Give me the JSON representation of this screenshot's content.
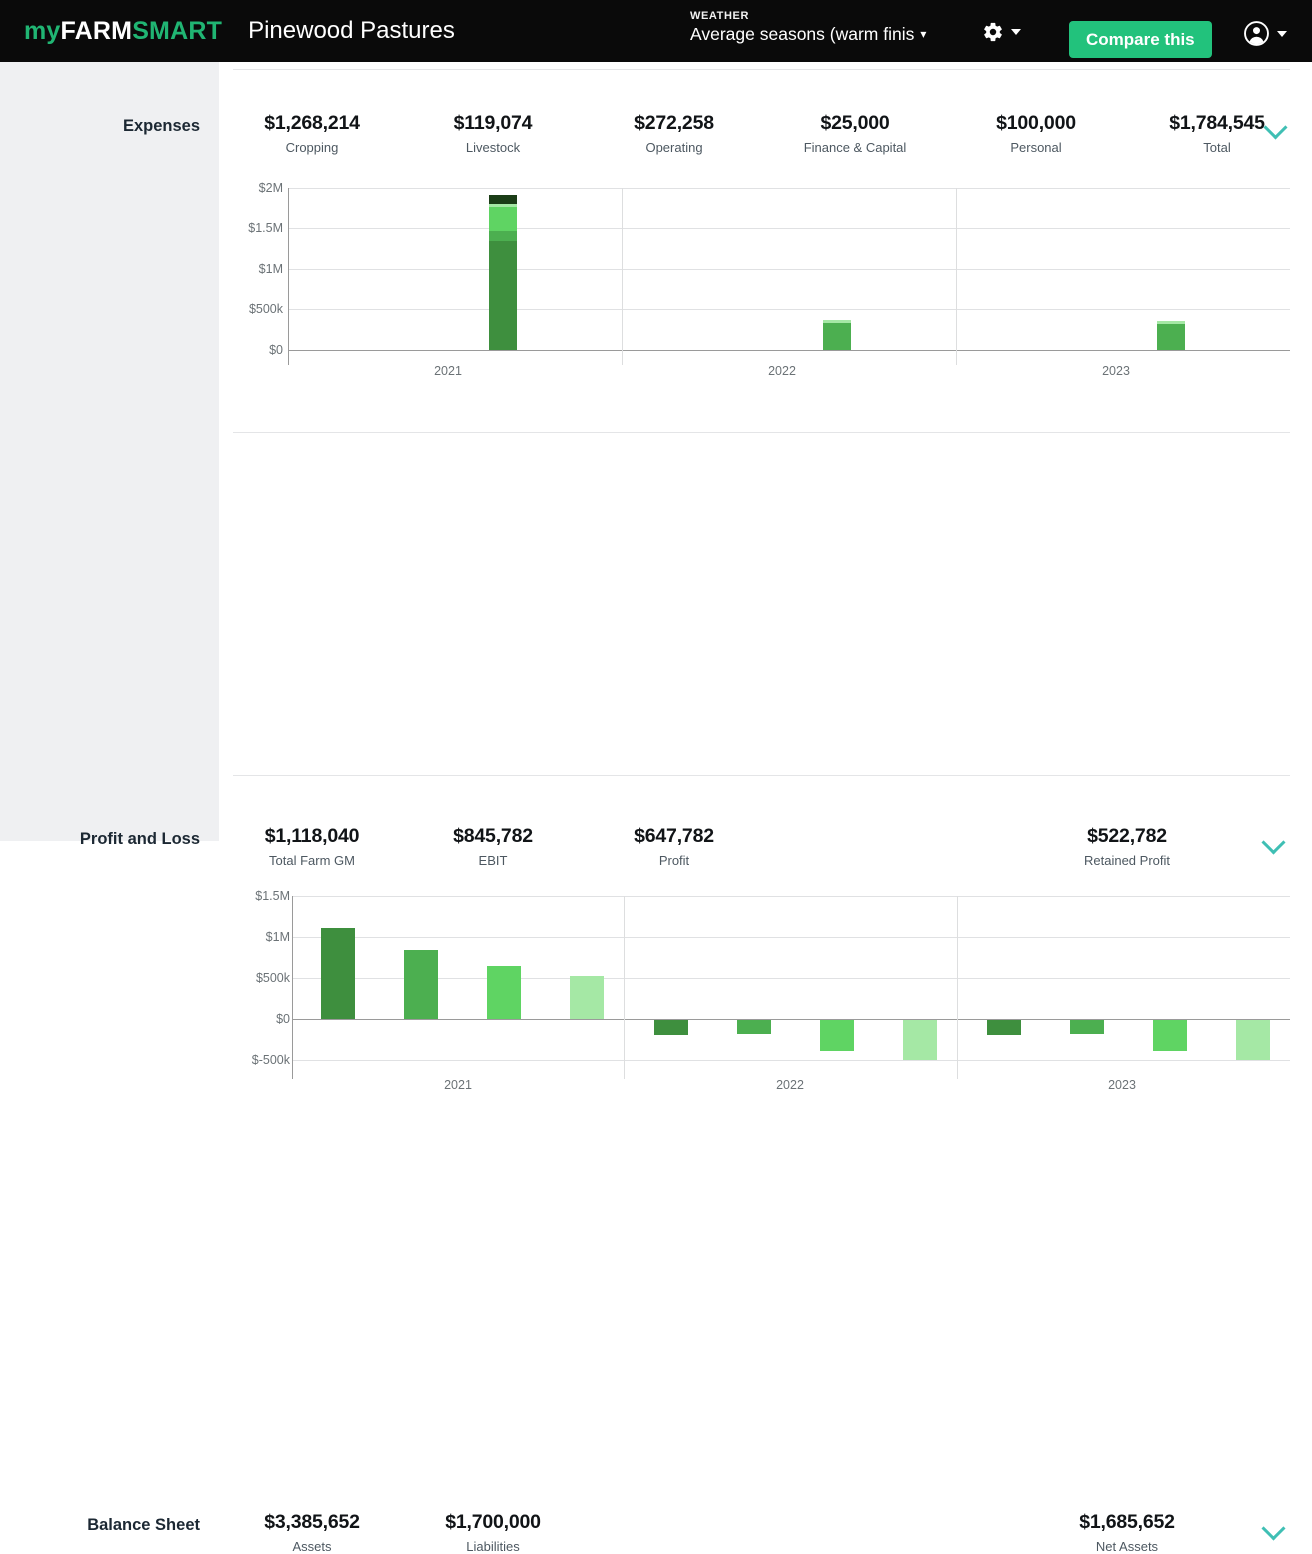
{
  "header": {
    "logo": {
      "part1": "my",
      "part2": "FARM",
      "part3": "SMART"
    },
    "farm_name": "Pinewood Pastures",
    "weather_label": "WEATHER",
    "weather_value": "Average seasons (warm finis",
    "weather_caret": "chevron-down-icon",
    "settings_icon": "gear-icon",
    "compare_button": "Compare this",
    "account_icon": "account-circle-icon",
    "brand_green": "#22c27c",
    "header_bg": "#0a0a0a"
  },
  "sections": [
    {
      "title": "Expenses",
      "kpis": [
        {
          "value": "$1,268,214",
          "label": "Cropping"
        },
        {
          "value": "$119,074",
          "label": "Livestock"
        },
        {
          "value": "$272,258",
          "label": "Operating"
        },
        {
          "value": "$25,000",
          "label": "Finance & Capital"
        },
        {
          "value": "$100,000",
          "label": "Personal"
        },
        {
          "value": "$1,784,545",
          "label": "Total"
        }
      ]
    },
    {
      "title": "Profit and Loss",
      "kpis": [
        {
          "value": "$1,118,040",
          "label": "Total Farm GM"
        },
        {
          "value": "$845,782",
          "label": "EBIT"
        },
        {
          "value": "$647,782",
          "label": "Profit"
        },
        {
          "value": "$522,782",
          "label": "Retained Profit"
        }
      ]
    },
    {
      "title": "Balance Sheet",
      "kpis": [
        {
          "value": "$3,385,652",
          "label": "Assets"
        },
        {
          "value": "$1,700,000",
          "label": "Liabilities"
        },
        {
          "value": "$1,685,652",
          "label": "Net Assets"
        }
      ]
    }
  ],
  "chart_data": [
    {
      "id": "expenses-chart",
      "type": "bar",
      "stacked": true,
      "title": "",
      "xlabel": "",
      "ylabel": "",
      "categories": [
        "2021",
        "2022",
        "2023"
      ],
      "ytick_labels": [
        "$2M",
        "$1.5M",
        "$1M",
        "$500k",
        "$0"
      ],
      "ytick_values": [
        2000000,
        1500000,
        1000000,
        500000,
        0
      ],
      "ylim": [
        0,
        2000000
      ],
      "grid": true,
      "legend": "none",
      "series": [
        {
          "name": "Cropping",
          "color": "#3e8f3e",
          "values": [
            1268214,
            335000,
            330000
          ]
        },
        {
          "name": "Livestock",
          "color": "#4caf50",
          "values": [
            119074,
            0,
            0
          ]
        },
        {
          "name": "Operating",
          "color": "#5fd463",
          "values": [
            272258,
            0,
            0
          ]
        },
        {
          "name": "Finance & Capital",
          "color": "#a5e8a5",
          "values": [
            25000,
            22000,
            22000
          ]
        },
        {
          "name": "Personal",
          "color": "#1b3d17",
          "values": [
            100000,
            0,
            0
          ]
        }
      ],
      "totals": [
        1784545,
        357000,
        352000
      ]
    },
    {
      "id": "profit-and-loss-chart",
      "type": "bar",
      "stacked": false,
      "title": "",
      "xlabel": "",
      "ylabel": "",
      "categories": [
        "2021",
        "2022",
        "2023"
      ],
      "ytick_labels": [
        "$1.5M",
        "$1M",
        "$500k",
        "$0",
        "$-500k"
      ],
      "ytick_values": [
        1500000,
        1000000,
        500000,
        0,
        -500000
      ],
      "ylim": [
        -500000,
        1500000
      ],
      "grid": true,
      "legend": "none",
      "series": [
        {
          "name": "Total Farm GM",
          "color": "#3e8f3e",
          "values": [
            1118040,
            -65000,
            -65000
          ]
        },
        {
          "name": "EBIT",
          "color": "#4caf50",
          "values": [
            845782,
            -62000,
            -62000
          ]
        },
        {
          "name": "Profit",
          "color": "#5fd463",
          "values": [
            647782,
            -180000,
            -180000
          ]
        },
        {
          "name": "Retained Profit",
          "color": "#a5e8a5",
          "values": [
            522782,
            -300000,
            -300000
          ]
        }
      ]
    }
  ]
}
